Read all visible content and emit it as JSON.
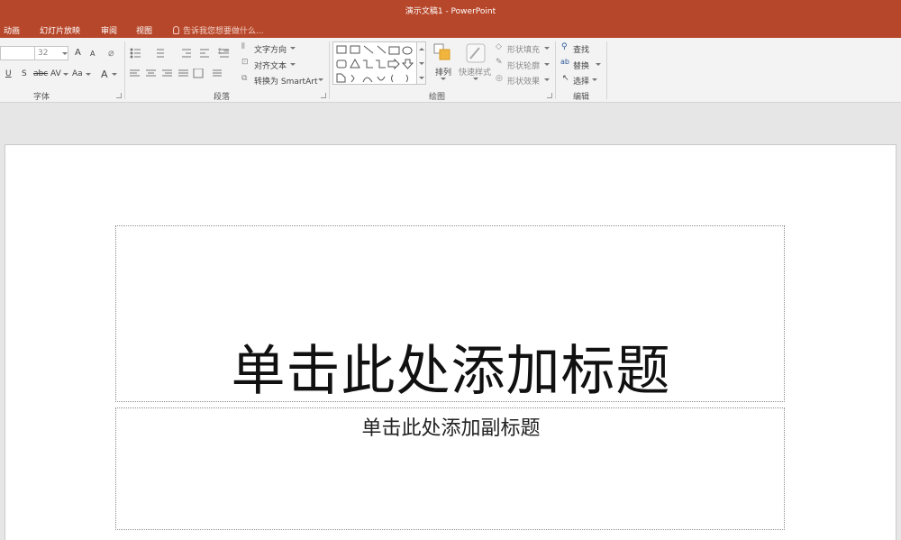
{
  "window": {
    "title": "演示文稿1 - PowerPoint"
  },
  "tabs": [
    {
      "label": "动画"
    },
    {
      "label": "幻灯片放映"
    },
    {
      "label": "审阅"
    },
    {
      "label": "视图"
    }
  ],
  "tellme": {
    "placeholder": "告诉我您想要做什么..."
  },
  "ribbon": {
    "font": {
      "label": "字体",
      "size_value": "32",
      "underline": "U",
      "shadow": "S",
      "strike": "abc",
      "spacing": "AV",
      "case": "Aa",
      "grow": "A",
      "shrink": "A",
      "color": "A"
    },
    "paragraph": {
      "label": "段落",
      "text_direction": "文字方向",
      "align_text": "对齐文本",
      "smartart": "转换为 SmartArt"
    },
    "drawing": {
      "label": "绘图",
      "arrange": "排列",
      "quick_styles": "快速样式",
      "shape_fill": "形状填充",
      "shape_outline": "形状轮廓",
      "shape_effects": "形状效果"
    },
    "editing": {
      "label": "编辑",
      "find": "查找",
      "replace": "替换",
      "select": "选择"
    }
  },
  "slide": {
    "title_placeholder": "单击此处添加标题",
    "subtitle_placeholder": "单击此处添加副标题"
  },
  "colors": {
    "accent": "#b7472a",
    "ribbon_bg": "#f3f3f3",
    "workspace_bg": "#e6e6e6"
  }
}
